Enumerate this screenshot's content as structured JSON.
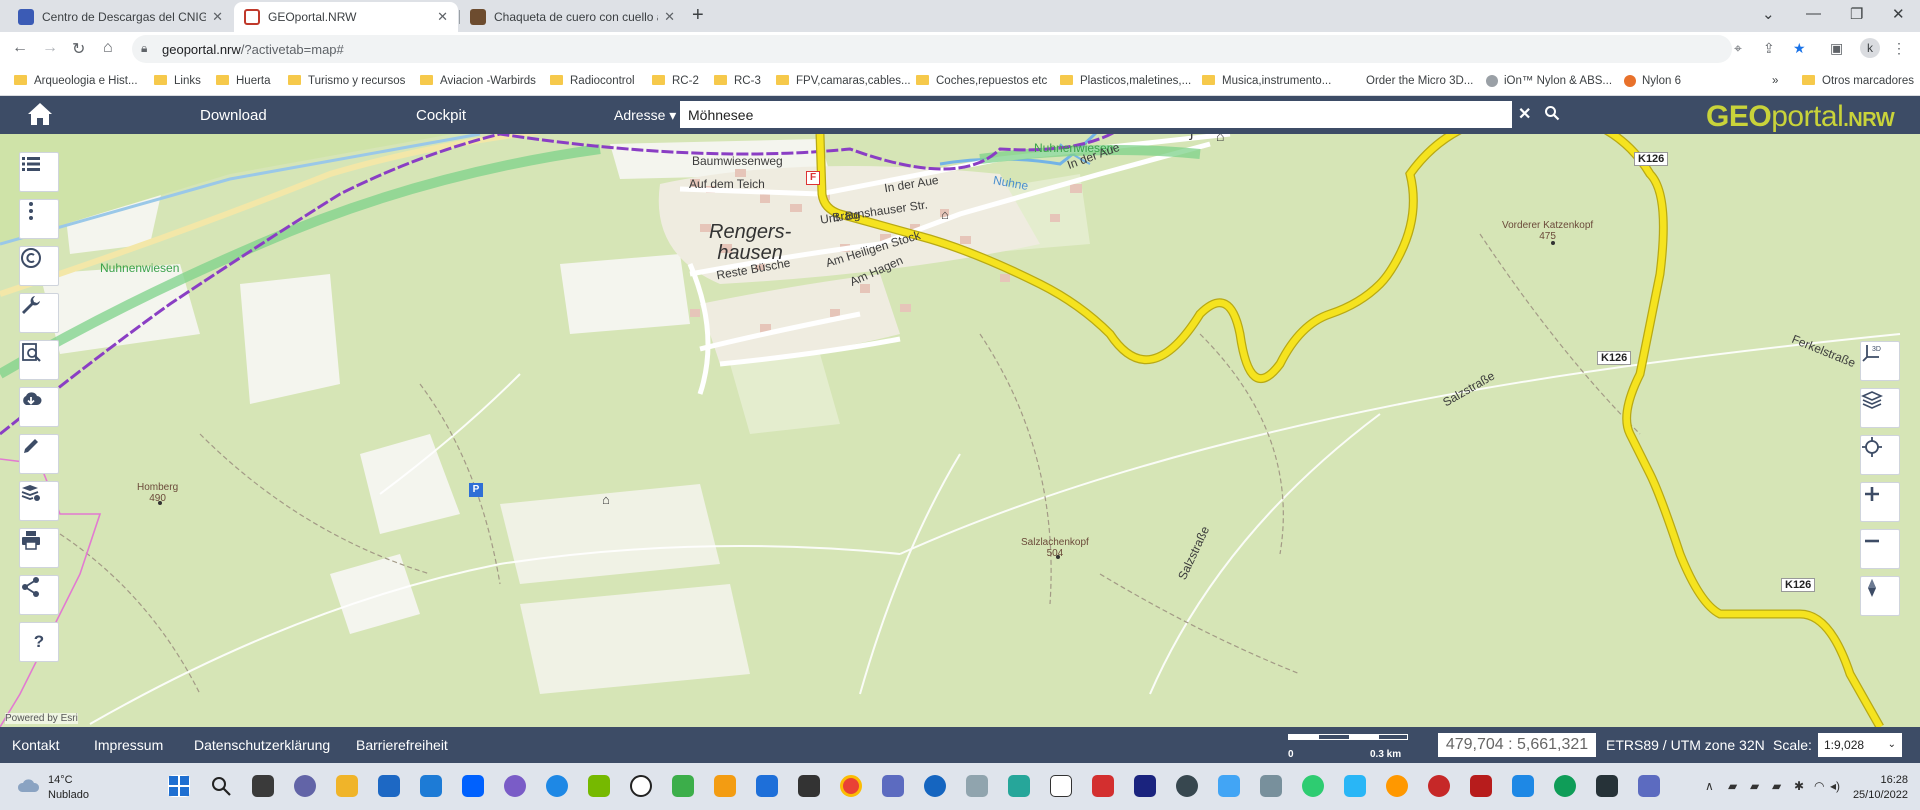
{
  "browser": {
    "tabs": [
      {
        "title": "Centro de Descargas del CNIG (I",
        "active": false,
        "color": "#3b5bb5"
      },
      {
        "title": "GEOportal.NRW",
        "active": true,
        "color": "#c0392b"
      },
      {
        "title": "Chaqueta de cuero con cuello alt",
        "active": false,
        "color": "#6d4c2f"
      }
    ],
    "url_host": "geoportal.nrw",
    "url_path": "/?activetab=map#",
    "profile_initial": "k",
    "bookmarks": [
      {
        "label": "Arqueologia e Hist...",
        "type": "folder"
      },
      {
        "label": "Links",
        "type": "folder"
      },
      {
        "label": "Huerta",
        "type": "folder"
      },
      {
        "label": "Turismo y recursos",
        "type": "folder"
      },
      {
        "label": "Aviacion -Warbirds",
        "type": "folder"
      },
      {
        "label": "Radiocontrol",
        "type": "folder"
      },
      {
        "label": "RC-2",
        "type": "folder"
      },
      {
        "label": "RC-3",
        "type": "folder"
      },
      {
        "label": "FPV,camaras,cables...",
        "type": "folder"
      },
      {
        "label": "Coches,repuestos etc",
        "type": "folder"
      },
      {
        "label": "Plasticos,maletines,...",
        "type": "folder"
      },
      {
        "label": "Musica,instrumento...",
        "type": "folder"
      },
      {
        "label": "Order the Micro 3D...",
        "type": "site"
      },
      {
        "label": "iOn™ Nylon & ABS...",
        "type": "site"
      },
      {
        "label": "Nylon 6",
        "type": "site"
      }
    ],
    "more_bookmarks": "»",
    "other_bookmarks": "Otros marcadores"
  },
  "app": {
    "nav": [
      "Download",
      "Cockpit"
    ],
    "search_mode": "Adresse ▾",
    "search_value": "Möhnesee",
    "logo_geo": "GEO",
    "logo_portal": "portal",
    "logo_nrw": ".NRW"
  },
  "map": {
    "labels": {
      "nuhnenwiesen_1": "Nuhnenwiesen",
      "nuhnenwiesen_2": "Nuhnenwiesen",
      "nuhne": "Nuhne",
      "baumwiesenweg": "Baumwiesenweg",
      "auf_dem_teich": "Auf dem Teich",
      "in_der_aue_1": "In der Aue",
      "in_der_aue_2": "In der Aue",
      "unt_bg": "Unt. Bg",
      "braunshauser": "Braunshauser Str.",
      "rengers": "Rengers-",
      "hausen": "hausen",
      "am_heiligen_stock": "Am Heiligen Stock",
      "reste_busche": "Reste Büsche",
      "am_hagen": "Am Hagen",
      "salzstrasse_1": "Salzstraße",
      "salzstrasse_2": "Salzstraße",
      "ferkelstrasse": "Ferkelstraße",
      "vorderer_katzenkopf": "Vorderer Katzenkopf",
      "vorderer_katzenkopf_h": "475",
      "homberg": "Homberg",
      "homberg_h": "490",
      "salzlachenkopf": "Salzlachenkopf",
      "salzlachenkopf_h": "504",
      "k126": "K126",
      "parking": "P",
      "fire": "F"
    },
    "powered_by": "Powered by Esri",
    "colors": {
      "forest": "#d4e4b4",
      "open": "#f3f4ec",
      "road_main": "#f5e31f",
      "boundary": "#8a3ec4",
      "water": "#6aa6dc"
    }
  },
  "footer": {
    "links": [
      "Kontakt",
      "Impressum",
      "Datenschutzerklärung",
      "Barrierefreiheit"
    ],
    "scale_zero": "0",
    "scale_max": "0.3 km",
    "coords": "479,704 : 5,661,321",
    "crs": "ETRS89 / UTM zone 32N",
    "scale_label": "Scale:",
    "scale_value": "1:9,028"
  },
  "taskbar": {
    "temperature": "14°C",
    "weather": "Nublado",
    "time": "16:28",
    "date": "25/10/2022"
  }
}
